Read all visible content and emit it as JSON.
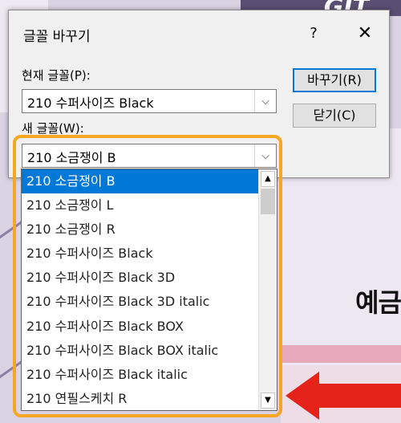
{
  "background": {
    "heading_fragment": "예금",
    "top_right_text": "GIT"
  },
  "dialog": {
    "title": "글꼴 바꾸기",
    "help_label": "?",
    "close_label": "✕",
    "current_font_label": "현재 글꼴(P):",
    "current_font_value": "210 수퍼사이즈 Black",
    "new_font_label": "새 글꼴(W):",
    "new_font_value": "210 소금쟁이 B",
    "replace_button": "바꾸기(R)",
    "close_button": "닫기(C)",
    "dropdown_arrow": "⌵"
  },
  "font_list": {
    "items": [
      "210 소금쟁이 B",
      "210 소금쟁이 L",
      "210 소금쟁이 R",
      "210 수퍼사이즈 Black",
      "210 수퍼사이즈 Black 3D",
      "210 수퍼사이즈 Black 3D italic",
      "210 수퍼사이즈 Black BOX",
      "210 수퍼사이즈 Black BOX italic",
      "210 수퍼사이즈 Black italic",
      "210 연필스케치 R"
    ],
    "selected_index": 0,
    "scroll_up": "▲",
    "scroll_down": "▼"
  },
  "colors": {
    "highlight": "#f5a623",
    "selection": "#0078d7",
    "arrow": "#e5231b"
  }
}
